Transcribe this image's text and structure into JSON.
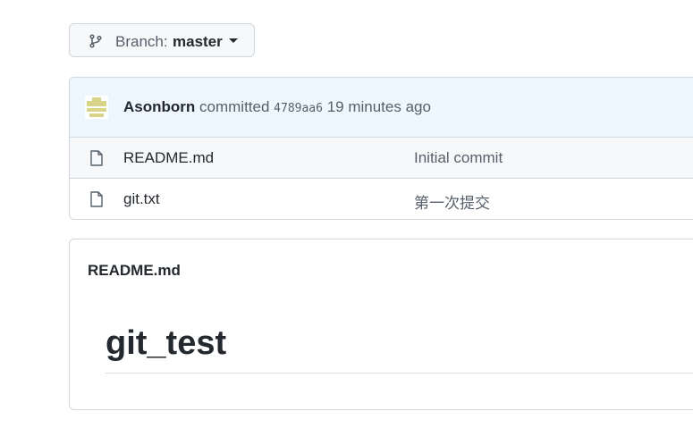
{
  "branch": {
    "prefix": "Branch:",
    "name": "master",
    "icon": "git-branch-icon"
  },
  "commit": {
    "author": "Asonborn",
    "verb": "committed",
    "sha": "4789aa6",
    "time": "19 minutes ago",
    "avatar_color": "#d8d48a"
  },
  "files": [
    {
      "name": "README.md",
      "message": "Initial commit",
      "icon": "file-icon"
    },
    {
      "name": "git.txt",
      "message": "第一次提交",
      "icon": "file-icon"
    }
  ],
  "readme": {
    "title": "README.md",
    "heading": "git_test"
  },
  "colors": {
    "commit_bar_bg": "#eef6fe",
    "border": "#d0d7de"
  }
}
